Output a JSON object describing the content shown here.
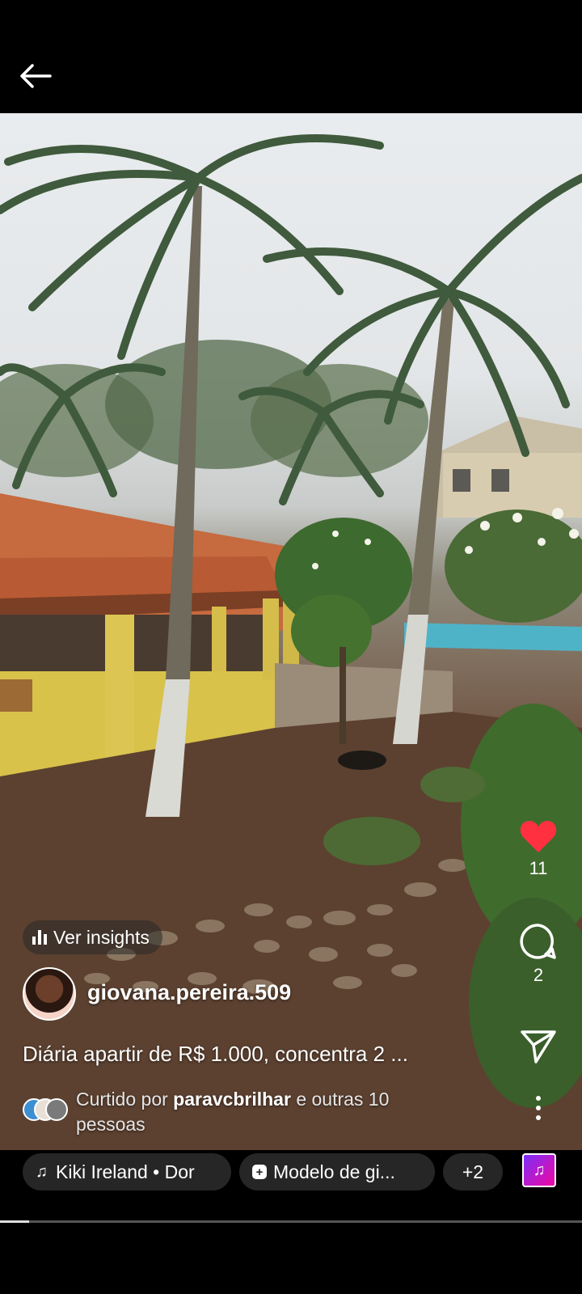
{
  "header": {
    "back_icon": "arrow-left-icon"
  },
  "post": {
    "insights_label": "Ver insights",
    "username": "giovana.pereira.509",
    "caption": "Diária apartir de R$ 1.000, concentra 2 ...",
    "liked_prefix": "Curtido por",
    "liked_user": "paravcbrilhar",
    "liked_suffix": "e outras 10 pessoas"
  },
  "actions": {
    "like_count": "11",
    "comment_count": "2",
    "like_color": "#ff3040"
  },
  "bottom": {
    "music_chip": "Kiki Ireland • Dor",
    "template_chip": "Modelo de gi...",
    "more_chip": "+2",
    "progress": 0.05
  }
}
